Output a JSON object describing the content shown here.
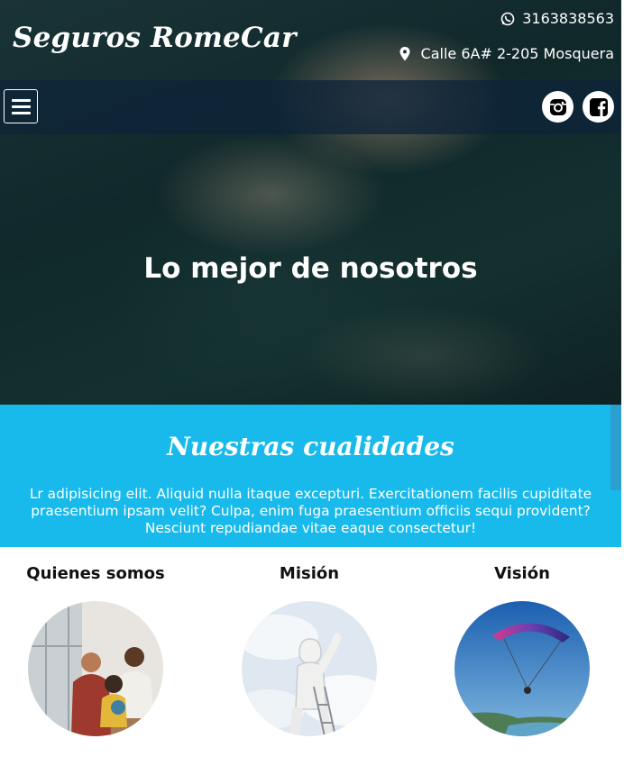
{
  "header": {
    "brand": "Seguros RomeCar",
    "phone": "3163838563",
    "address": "Calle 6A# 2-205 Mosquera",
    "phone_icon": "whatsapp-icon",
    "address_icon": "map-marker-icon"
  },
  "nav": {
    "menu_icon": "hamburger-icon",
    "social": [
      "instagram-icon",
      "facebook-icon"
    ]
  },
  "hero": {
    "title": "Lo mejor de nosotros"
  },
  "qualities": {
    "title": "Nuestras cualidades",
    "text": "Lr adipisicing elit. Aliquid nulla itaque excepturi. Exercitationem facilis cupiditate praesentium ipsam velit? Culpa, enim fuga praesentium officiis sequi provident? Nesciunt repudiandae vitae eaque consectetur!"
  },
  "sections": [
    {
      "title": "Quienes somos"
    },
    {
      "title": "Misión"
    },
    {
      "title": "Visión"
    }
  ],
  "colors": {
    "accent": "#18baec",
    "navbar": "#0e243a"
  }
}
